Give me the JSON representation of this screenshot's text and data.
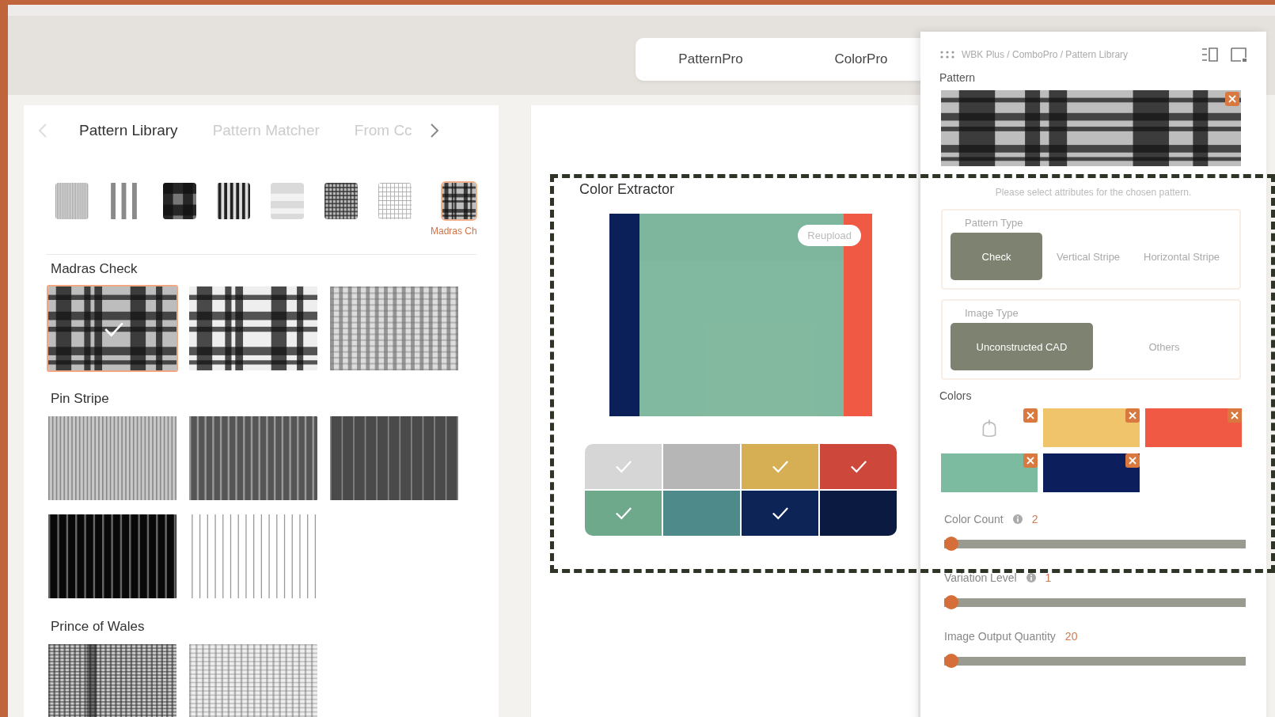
{
  "mode_switch": [
    {
      "label": "PatternPro",
      "selected": false
    },
    {
      "label": "ColorPro",
      "selected": false
    }
  ],
  "library": {
    "prev_disabled": true,
    "tabs": [
      {
        "label": "Pattern Library",
        "selected": true
      },
      {
        "label": "Pattern Matcher",
        "selected": false
      },
      {
        "label": "From Cc",
        "selected": false
      }
    ],
    "categories": [
      {
        "kind": "fine",
        "selected": false
      },
      {
        "kind": "bars",
        "selected": false
      },
      {
        "kind": "buffalo",
        "selected": false
      },
      {
        "kind": "bold",
        "selected": false
      },
      {
        "kind": "plain",
        "selected": false
      },
      {
        "kind": "grid",
        "selected": false
      },
      {
        "kind": "windowpane",
        "selected": false
      },
      {
        "kind": "madras",
        "selected": true
      }
    ],
    "selected_category_label": "Madras Ch",
    "sections": [
      {
        "title": "Madras Check",
        "patterns": [
          {
            "kind": "madras",
            "selected": true
          },
          {
            "kind": "tartan",
            "selected": false
          },
          {
            "kind": "glen",
            "selected": false
          }
        ]
      },
      {
        "title": "Pin Stripe",
        "patterns": [
          {
            "kind": "pinlight",
            "selected": false
          },
          {
            "kind": "pindark",
            "selected": false
          },
          {
            "kind": "pingrey",
            "selected": false
          },
          {
            "kind": "pinblack",
            "selected": false
          },
          {
            "kind": "pinwhite",
            "selected": false
          }
        ]
      },
      {
        "title": "Prince of Wales",
        "patterns": [
          {
            "kind": "pow",
            "selected": false
          },
          {
            "kind": "powlight",
            "selected": false
          }
        ]
      }
    ]
  },
  "extractor": {
    "title": "Color Extractor",
    "reupload": "Reupload",
    "colors": [
      {
        "color": "#d6d6d6",
        "checked": true
      },
      {
        "color": "#b6b6b6",
        "checked": false
      },
      {
        "color": "#d6af55",
        "checked": true
      },
      {
        "color": "#cd473b",
        "checked": true
      },
      {
        "color": "#6ea98b",
        "checked": true
      },
      {
        "color": "#4f8a8a",
        "checked": false
      },
      {
        "color": "#0d2457",
        "checked": true
      },
      {
        "color": "#0a1a40",
        "checked": false
      }
    ]
  },
  "drawer": {
    "breadcrumb": "WBK Plus / ComboPro / Pattern Library",
    "pattern_label": "Pattern",
    "hint": "Please select attributes for the chosen pattern.",
    "pattern_type": {
      "label": "Pattern Type",
      "options": [
        {
          "label": "Check",
          "selected": true
        },
        {
          "label": "Vertical Stripe",
          "selected": false
        },
        {
          "label": "Horizontal Stripe",
          "selected": false
        }
      ]
    },
    "image_type": {
      "label": "Image Type",
      "options": [
        {
          "label": "Unconstructed CAD",
          "selected": true
        },
        {
          "label": "Others",
          "selected": false
        }
      ]
    },
    "colors_label": "Colors",
    "colors": [
      {
        "color": "#f0c46a"
      },
      {
        "color": "#f05a45"
      },
      {
        "color": "#7dbba0"
      },
      {
        "color": "#0c1f5c"
      }
    ],
    "sliders": [
      {
        "label": "Color Count",
        "info": true,
        "reading": "2",
        "level": 0
      },
      {
        "label": "Variation Level",
        "info": true,
        "reading": "1",
        "level": 0
      },
      {
        "label": "Image Output Quantity",
        "info": false,
        "reading": "20",
        "level": 0
      }
    ]
  }
}
